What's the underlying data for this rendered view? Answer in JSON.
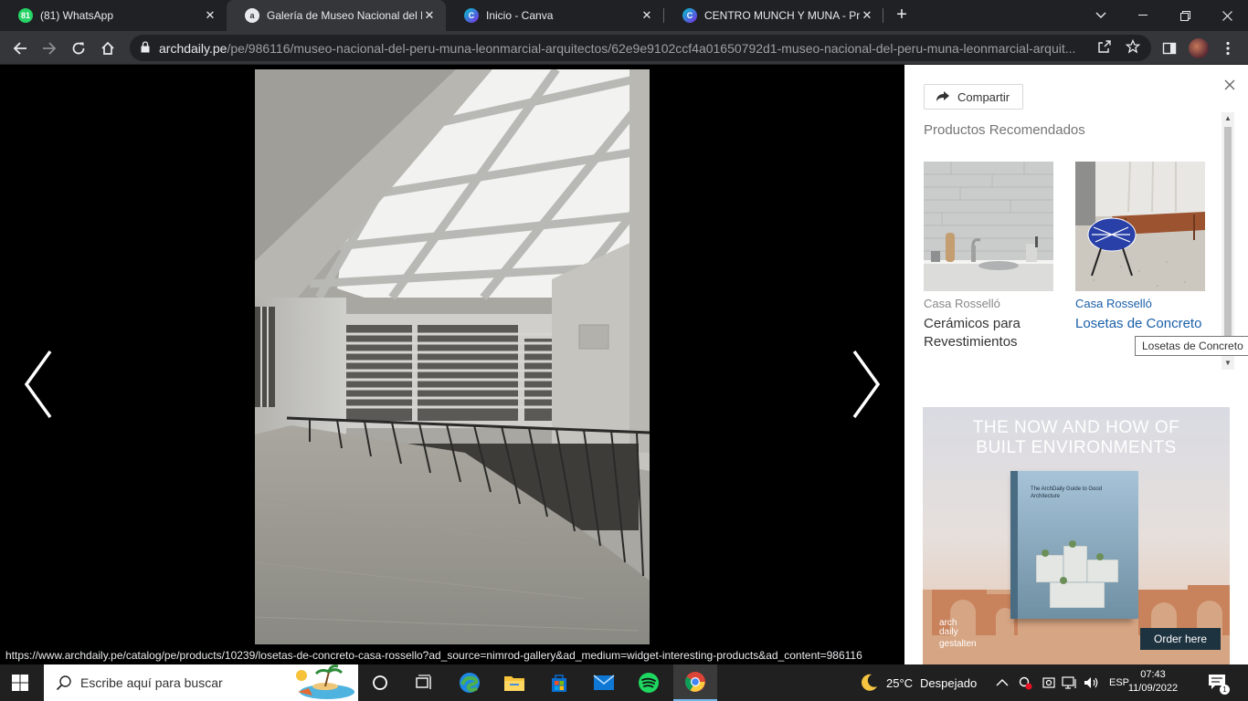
{
  "browser": {
    "tabs": [
      {
        "title": "(81) WhatsApp",
        "favicon": "whatsapp-icon",
        "active": false
      },
      {
        "title": "Galería de Museo Nacional del Perú",
        "favicon": "archdaily-icon",
        "active": true
      },
      {
        "title": "Inicio - Canva",
        "favicon": "canva-icon",
        "active": false
      },
      {
        "title": "CENTRO MUNCH Y MUNA - Presentación",
        "favicon": "canva-icon",
        "active": false
      }
    ],
    "whatsapp_badge": "81",
    "url_host": "archdaily.pe",
    "url_path": "/pe/986116/museo-nacional-del-peru-muna-leonmarcial-arquitectos/62e9e9102ccf4a01650792d1-museo-nacional-del-peru-muna-leonmarcial-arquit..."
  },
  "gallery": {
    "prev_icon": "chevron-left-icon",
    "next_icon": "chevron-right-icon"
  },
  "panel": {
    "share_label": "Compartir",
    "section_title": "Productos Recomendados",
    "products": [
      {
        "brand": "Casa Rosselló",
        "name": "Cerámicos para Revestimientos"
      },
      {
        "brand": "Casa Rosselló",
        "name": "Losetas de Concreto"
      }
    ],
    "tooltip": "Losetas de Concreto",
    "ad": {
      "headline_line1": "THE NOW AND HOW OF",
      "headline_line2": "BUILT ENVIRONMENTS",
      "book_title": "The ArchDaily Guide to Good Architecture",
      "logo_line1": "arch",
      "logo_line2": "daily",
      "logo_line3": "gestalten",
      "cta": "Order here"
    }
  },
  "status_url": "https://www.archdaily.pe/catalog/pe/products/10239/losetas-de-concreto-casa-rossello?ad_source=nimrod-gallery&ad_medium=widget-interesting-products&ad_content=986116",
  "taskbar": {
    "search_placeholder": "Escribe aquí para buscar",
    "weather_temp": "25°C",
    "weather_desc": "Despejado",
    "language": "ESP",
    "time": "07:43",
    "date": "11/09/2022",
    "notification_count": "1"
  },
  "colors": {
    "chrome_dark": "#202124",
    "chrome_toolbar": "#35363a",
    "link_blue": "#1a5fa8",
    "taskbar": "#202020"
  }
}
